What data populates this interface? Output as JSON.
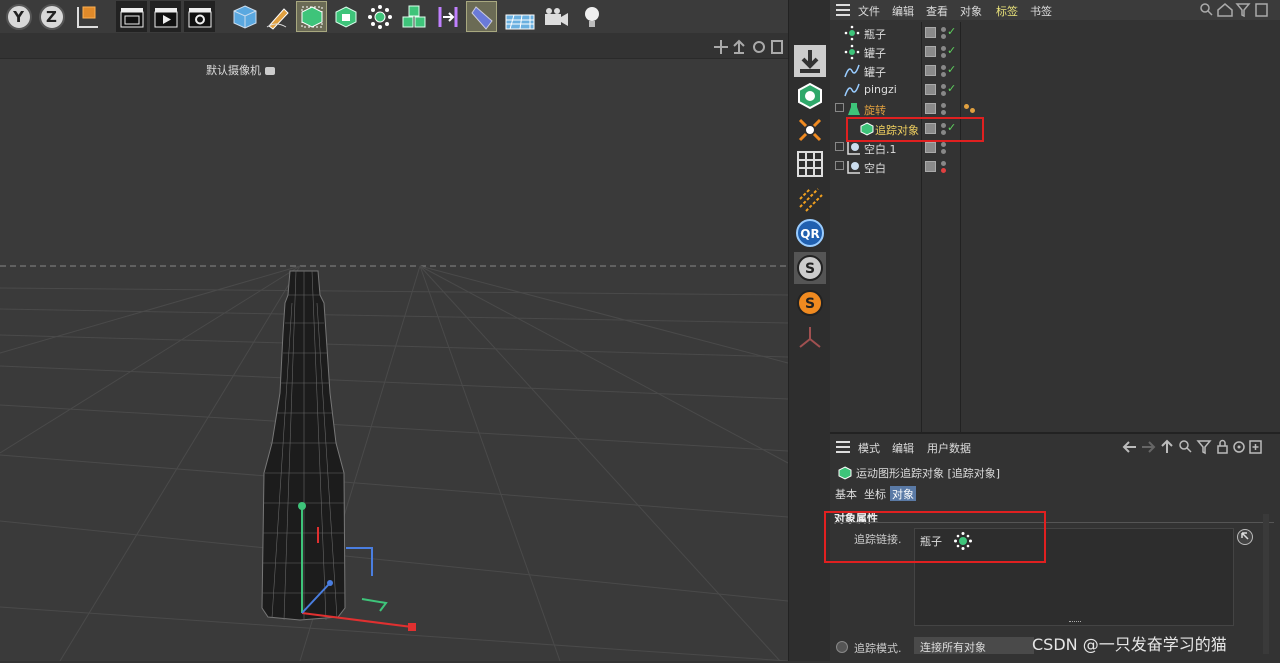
{
  "toolbar": {
    "axis_y": "Y",
    "axis_z": "Z"
  },
  "viewport": {
    "camera_label": "默认摄像机"
  },
  "object_manager": {
    "menu": [
      "文件",
      "编辑",
      "查看",
      "对象",
      "标签",
      "书签"
    ],
    "active_menu": "标签",
    "rows": [
      {
        "name": "瓶子",
        "icon": "cloner-icon"
      },
      {
        "name": "罐子",
        "icon": "cloner-icon"
      },
      {
        "name": "罐子",
        "icon": "spline-icon"
      },
      {
        "name": "pingzi",
        "icon": "spline-icon"
      },
      {
        "name": "旋转",
        "icon": "lathe-icon"
      },
      {
        "name": "追踪对象",
        "icon": "tracer-icon"
      },
      {
        "name": "空白.1",
        "icon": "null-icon"
      },
      {
        "name": "空白",
        "icon": "null-icon"
      }
    ]
  },
  "attribute_manager": {
    "menu": [
      "模式",
      "编辑",
      "用户数据"
    ],
    "object_title": "运动图形追踪对象 [追踪对象]",
    "tabs": [
      "基本",
      "坐标",
      "对象"
    ],
    "active_tab": "对象",
    "section_title": "对象属性",
    "trace_link_label": "追踪链接.",
    "trace_link_value": "瓶子",
    "trace_mode_label": "追踪模式.",
    "trace_mode_value": "连接所有对象"
  },
  "watermark": "CSDN @一只发奋学习的猫",
  "colors": {
    "highlight_red": "#e02020",
    "accent_green": "#5fd35f",
    "active_tab_blue": "#5a7aa6"
  }
}
